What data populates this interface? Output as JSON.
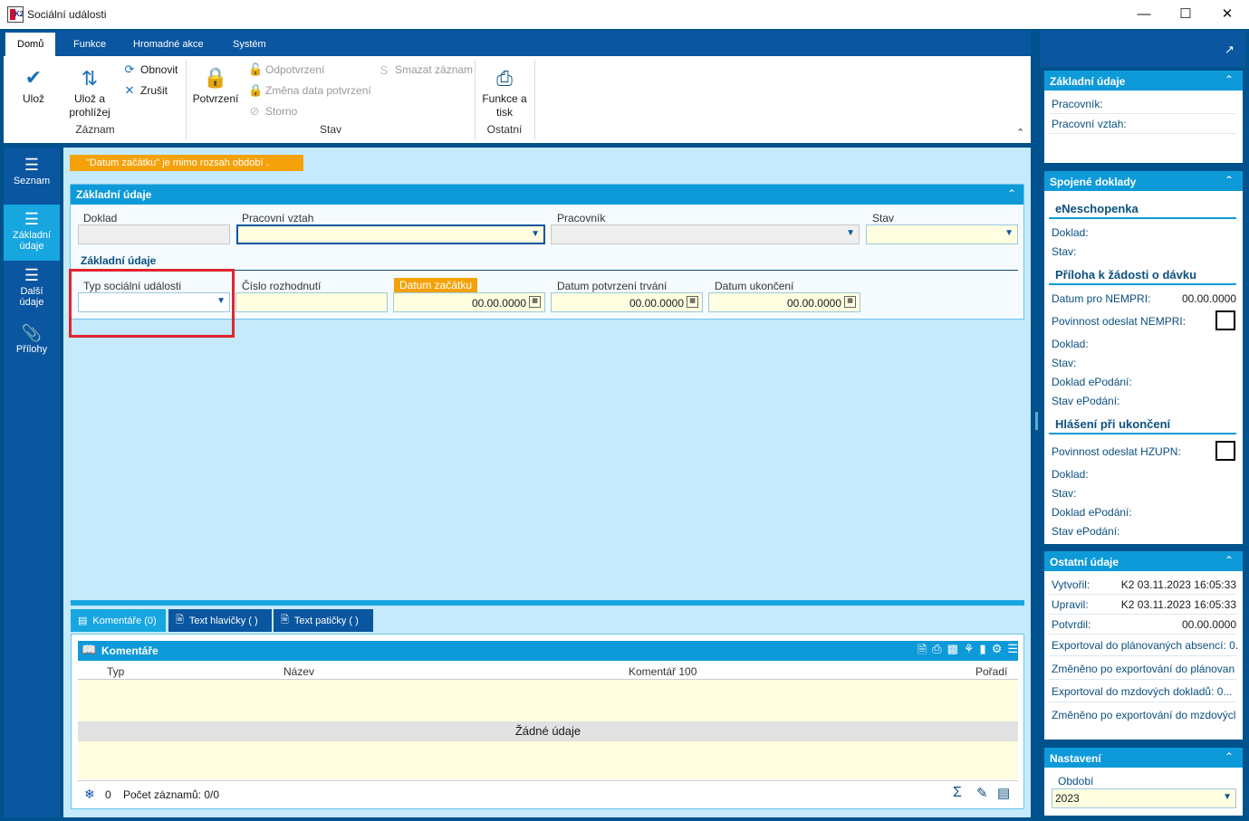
{
  "window": {
    "title": "Sociální události"
  },
  "ribbon": {
    "tabs": [
      "Domů",
      "Funkce",
      "Hromadné akce",
      "Systém"
    ],
    "save": "Ulož",
    "save_browse": "Ulož a prohlížej",
    "refresh": "Obnovit",
    "cancel": "Zrušit",
    "confirm": "Potvrzení",
    "unconfirm": "Odpotvrzení",
    "change_date": "Změna data potvrzení",
    "storno": "Storno",
    "delete": "Smazat záznam",
    "functions": "Funkce a tisk",
    "groups": {
      "record": "Záznam",
      "state": "Stav",
      "other": "Ostatní"
    }
  },
  "leftnav": {
    "items": [
      "Seznam",
      "Základní údaje",
      "Další údaje",
      "Přílohy"
    ]
  },
  "warning": "\"Datum začátku\" je mimo rozsah období .",
  "form": {
    "title": "Základní údaje",
    "doklad_label": "Doklad",
    "pracovni_vztah_label": "Pracovní vztah",
    "pracovnik_label": "Pracovník",
    "stav_label": "Stav",
    "subtitle": "Základní údaje",
    "typ_label": "Typ sociální události",
    "cislo_label": "Číslo rozhodnutí",
    "datum_zacatku_label": "Datum začátku",
    "datum_potvrzeni_label": "Datum potvrzení trvání",
    "datum_ukonceni_label": "Datum ukončení",
    "datum_zacatku": "00.00.0000",
    "datum_potvrzeni": "00.00.0000",
    "datum_ukonceni": "00.00.0000"
  },
  "bottom_tabs": [
    "Komentáře (0)",
    "Text hlavičky ( )",
    "Text patičky ( )"
  ],
  "komentare": {
    "title": "Komentáře",
    "columns": [
      "Typ",
      "Název",
      "Komentář 100",
      "Pořadí"
    ],
    "empty": "Žádné údaje",
    "count": "0",
    "records": "Počet záznamů: 0/0"
  },
  "right": {
    "zakladni": {
      "title": "Základní údaje",
      "pracovnik": "Pracovník:",
      "pracovni_vztah": "Pracovní vztah:"
    },
    "spojene": {
      "title": "Spojené doklady",
      "eneschopenka": "eNeschopenka",
      "doklad": "Doklad:",
      "stav": "Stav:",
      "priloha": "Příloha k žádosti o dávku",
      "datum_nempri": "Datum pro NEMPRI:",
      "datum_nempri_val": "00.00.0000",
      "povinnost_nempri": "Povinnost odeslat NEMPRI:",
      "doklad_epodani": "Doklad ePodání:",
      "stav_epodani": "Stav ePodání:",
      "hlaseni": "Hlášení při ukončení",
      "povinnost_hzupn": "Povinnost odeslat HZUPN:"
    },
    "ostatni": {
      "title": "Ostatní údaje",
      "vytvoril": "Vytvořil:",
      "vytvoril_val": "K2 03.11.2023 16:05:33",
      "upravil": "Upravil:",
      "upravil_val": "K2 03.11.2023 16:05:33",
      "potvrdil": "Potvrdil:",
      "potvrdil_val": "00.00.0000",
      "export_plan": "Exportoval do plánovaných absencí: 0.",
      "zmeneno_plan": "Změněno po exportování do plánovan",
      "export_mzd": "Exportoval do mzdových dokladů: 0...",
      "zmeneno_mzd": "Změněno po exportování do mzdovýcl"
    },
    "nastaveni": {
      "title": "Nastavení",
      "obdobi_label": "Období",
      "obdobi": "2023"
    }
  }
}
